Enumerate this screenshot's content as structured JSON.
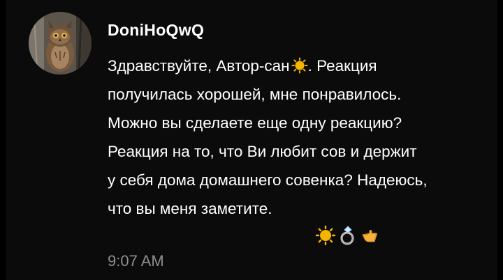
{
  "comment": {
    "username": "DoniHoQwQ",
    "avatar_icon": "owl-avatar",
    "message_lines": [
      {
        "text": "Здравствуйте, Автор-сан",
        "emoji": "sun-emoji",
        "after": ". Реакция"
      },
      {
        "text": "получилась хорошей, мне понравилось."
      },
      {
        "text": "Можно вы сделаете еще одну реакцию?"
      },
      {
        "text": "Реакция на то, что Ви любит сов и держит"
      },
      {
        "text": "у себя дома домашнего совенка? Надеюсь,"
      },
      {
        "text": "что вы меня заметите."
      }
    ],
    "trailing_emojis": [
      "sun-emoji",
      "ring-emoji",
      "pointing-hand-emoji"
    ],
    "timestamp": "9:07 AM"
  },
  "colors": {
    "background": "#0b0b0b",
    "text": "#ffffff",
    "timestamp": "#8e8e8e",
    "sun": "#f5b400"
  }
}
